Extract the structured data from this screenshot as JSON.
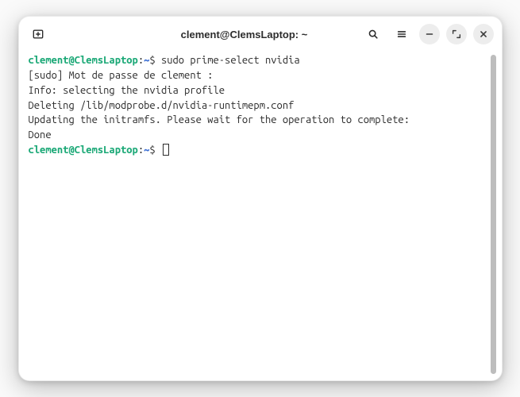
{
  "header": {
    "title": "clement@ClemsLaptop: ~"
  },
  "colors": {
    "prompt_user": "#1aa876",
    "prompt_path": "#3a6ed4",
    "text": "#2c2c2c"
  },
  "terminal": {
    "prompt1_userhost": "clement@ClemsLaptop",
    "prompt1_sep": ":",
    "prompt1_path": "~",
    "prompt1_sigil": "$ ",
    "cmd1": "sudo prime-select nvidia",
    "out_lines": [
      "[sudo] Mot de passe de clement : ",
      "Info: selecting the nvidia profile",
      "Deleting /lib/modprobe.d/nvidia-runtimepm.conf",
      "Updating the initramfs. Please wait for the operation to complete:",
      "Done"
    ],
    "prompt2_userhost": "clement@ClemsLaptop",
    "prompt2_sep": ":",
    "prompt2_path": "~",
    "prompt2_sigil": "$ "
  }
}
